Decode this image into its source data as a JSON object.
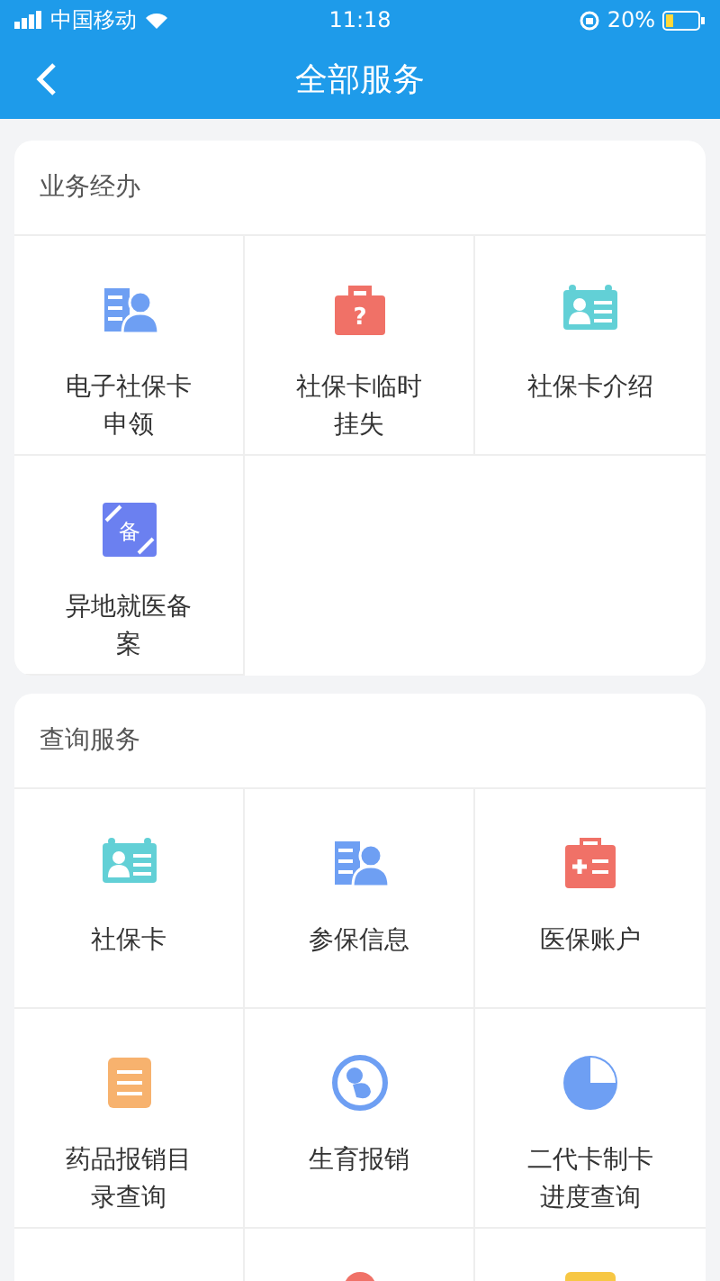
{
  "status_bar": {
    "carrier": "中国移动",
    "time": "11:18",
    "battery": "20%"
  },
  "nav": {
    "title": "全部服务"
  },
  "sections": [
    {
      "title": "业务经办",
      "items": [
        {
          "kind": "person-doc",
          "label": "电子社保卡申领"
        },
        {
          "kind": "bag",
          "glyph": "?",
          "label": "社保卡临时挂失"
        },
        {
          "kind": "id-card",
          "label": "社保卡介绍"
        },
        {
          "kind": "transfer",
          "glyph": "备",
          "label": "异地就医备案"
        }
      ]
    },
    {
      "title": "查询服务",
      "items": [
        {
          "kind": "id-card",
          "label": "社保卡"
        },
        {
          "kind": "person-doc",
          "label": "参保信息"
        },
        {
          "kind": "medical",
          "label": "医保账户"
        },
        {
          "kind": "list",
          "label": "药品报销目录查询"
        },
        {
          "kind": "baby",
          "label": "生育报销"
        },
        {
          "kind": "pie",
          "label": "二代卡制卡进度查询"
        },
        {
          "kind": "none"
        },
        {
          "kind": "pin"
        },
        {
          "kind": "tag"
        }
      ]
    }
  ]
}
